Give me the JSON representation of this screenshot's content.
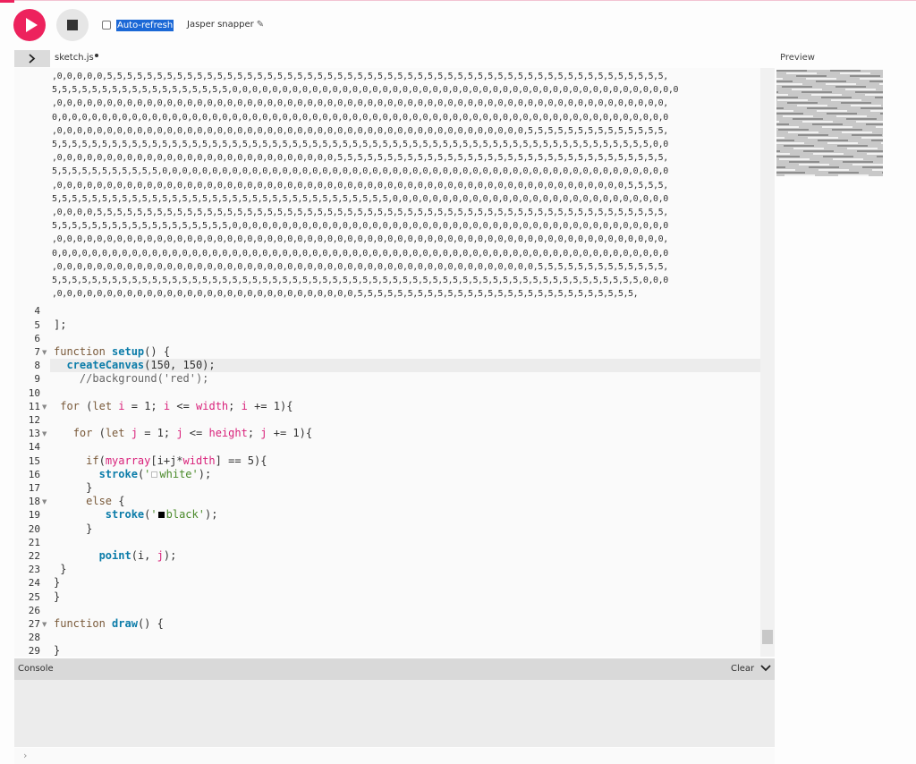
{
  "toolbar": {
    "play_icon": "play-icon",
    "stop_icon": "stop-icon",
    "auto_refresh_label": "Auto-refresh",
    "project_name": "Jasper snapper",
    "pencil_icon": "✎"
  },
  "file_header": {
    "toggle_icon": "chevron-right-icon",
    "file_name": "sketch.js",
    "preview_label": "Preview"
  },
  "editor": {
    "data_lines": [
      ",0,0,0,0,0,5,5,5,5,5,5,5,5,5,5,5,5,5,5,5,5,5,5,5,5,5,5,5,5,5,5,5,5,5,5,5,5,5,5,5,5,5,5,5,5,5,5,5,5,5,5,5,5,5,5,5,5,5,5,5,5,",
      "5,5,5,5,5,5,5,5,5,5,5,5,5,5,5,5,5,5,0,0,0,0,0,0,0,0,0,0,0,0,0,0,0,0,0,0,0,0,0,0,0,0,0,0,0,0,0,0,0,0,0,0,0,0,0,0,0,0,0,0,0,0,0",
      ",0,0,0,0,0,0,0,0,0,0,0,0,0,0,0,0,0,0,0,0,0,0,0,0,0,0,0,0,0,0,0,0,0,0,0,0,0,0,0,0,0,0,0,0,0,0,0,0,0,0,0,0,0,0,0,0,0,0,0,0,0,",
      "0,0,0,0,0,0,0,0,0,0,0,0,0,0,0,0,0,0,0,0,0,0,0,0,0,0,0,0,0,0,0,0,0,0,0,0,0,0,0,0,0,0,0,0,0,0,0,0,0,0,0,0,0,0,0,0,0,0,0,0,0,0",
      ",0,0,0,0,0,0,0,0,0,0,0,0,0,0,0,0,0,0,0,0,0,0,0,0,0,0,0,0,0,0,0,0,0,0,0,0,0,0,0,0,0,0,0,0,0,0,0,5,5,5,5,5,5,5,5,5,5,5,5,5,5,",
      "5,5,5,5,5,5,5,5,5,5,5,5,5,5,5,5,5,5,5,5,5,5,5,5,5,5,5,5,5,5,5,5,5,5,5,5,5,5,5,5,5,5,5,5,5,5,5,5,5,5,5,5,5,5,5,5,5,5,5,5,0,0",
      ",0,0,0,0,0,0,0,0,0,0,0,0,0,0,0,0,0,0,0,0,0,0,0,0,0,0,0,0,5,5,5,5,5,5,5,5,5,5,5,5,5,5,5,5,5,5,5,5,5,5,5,5,5,5,5,5,5,5,5,5,5,",
      "5,5,5,5,5,5,5,5,5,5,5,0,0,0,0,0,0,0,0,0,0,0,0,0,0,0,0,0,0,0,0,0,0,0,0,0,0,0,0,0,0,0,0,0,0,0,0,0,0,0,0,0,0,0,0,0,0,0,0,0,0,0",
      ",0,0,0,0,0,0,0,0,0,0,0,0,0,0,0,0,0,0,0,0,0,0,0,0,0,0,0,0,0,0,0,0,0,0,0,0,0,0,0,0,0,0,0,0,0,0,0,0,0,0,0,0,0,0,0,0,0,5,5,5,5,",
      "5,5,5,5,5,5,5,5,5,5,5,5,5,5,5,5,5,5,5,5,5,5,5,5,5,5,5,5,5,5,5,5,5,5,0,0,0,0,0,0,0,0,0,0,0,0,0,0,0,0,0,0,0,0,0,0,0,0,0,0,0,0",
      ",0,0,0,0,5,5,5,5,5,5,5,5,5,5,5,5,5,5,5,5,5,5,5,5,5,5,5,5,5,5,5,5,5,5,5,5,5,5,5,5,5,5,5,5,5,5,5,5,5,5,5,5,5,5,5,5,5,5,5,5,5,",
      "5,5,5,5,5,5,5,5,5,5,5,5,5,5,5,5,5,5,0,0,0,0,0,0,0,0,0,0,0,0,0,0,0,0,0,0,0,0,0,0,0,0,0,0,0,0,0,0,0,0,0,0,0,0,0,0,0,0,0,0,0,0",
      ",0,0,0,0,0,0,0,0,0,0,0,0,0,0,0,0,0,0,0,0,0,0,0,0,0,0,0,0,0,0,0,0,0,0,0,0,0,0,0,0,0,0,0,0,0,0,0,0,0,0,0,0,0,0,0,0,0,0,0,0,0,",
      "0,0,0,0,0,0,0,0,0,0,0,0,0,0,0,0,0,0,0,0,0,0,0,0,0,0,0,0,0,0,0,0,0,0,0,0,0,0,0,0,0,0,0,0,0,0,0,0,0,0,0,0,0,0,0,0,0,0,0,0,0,0",
      ",0,0,0,0,0,0,0,0,0,0,0,0,0,0,0,0,0,0,0,0,0,0,0,0,0,0,0,0,0,0,0,0,0,0,0,0,0,0,0,0,0,0,0,0,0,0,0,0,5,5,5,5,5,5,5,5,5,5,5,5,5,",
      "5,5,5,5,5,5,5,5,5,5,5,5,5,5,5,5,5,5,5,5,5,5,5,5,5,5,5,5,5,5,5,5,5,5,5,5,5,5,5,5,5,5,5,5,5,5,5,5,5,5,5,5,5,5,5,5,5,5,5,0,0,0",
      ",0,0,0,0,0,0,0,0,0,0,0,0,0,0,0,0,0,0,0,0,0,0,0,0,0,0,0,0,0,0,5,5,5,5,5,5,5,5,5,5,5,5,5,5,5,5,5,5,5,5,5,5,5,5,5,5,5,5,"
    ],
    "code_lines": [
      {
        "num": "4",
        "text": ""
      },
      {
        "num": "5",
        "text": "];"
      },
      {
        "num": "6",
        "text": ""
      },
      {
        "num": "7",
        "text": "function setup() {"
      },
      {
        "num": "8",
        "text": "  createCanvas(150, 150);"
      },
      {
        "num": "9",
        "text": "    //background('red');"
      },
      {
        "num": "10",
        "text": ""
      },
      {
        "num": "11",
        "text": " for (let i = 1; i <= width; i += 1){"
      },
      {
        "num": "12",
        "text": ""
      },
      {
        "num": "13",
        "text": "   for (let j = 1; j <= height; j += 1){"
      },
      {
        "num": "14",
        "text": ""
      },
      {
        "num": "15",
        "text": "     if(myarray[i+j*width] == 5){"
      },
      {
        "num": "16",
        "text": "       stroke('white');"
      },
      {
        "num": "17",
        "text": "     }"
      },
      {
        "num": "18",
        "text": "     else {"
      },
      {
        "num": "19",
        "text": "        stroke('black');"
      },
      {
        "num": "20",
        "text": "     }"
      },
      {
        "num": "21",
        "text": ""
      },
      {
        "num": "22",
        "text": "       point(i, j);"
      },
      {
        "num": "23",
        "text": " }"
      },
      {
        "num": "24",
        "text": "}"
      },
      {
        "num": "25",
        "text": "}"
      },
      {
        "num": "26",
        "text": ""
      },
      {
        "num": "27",
        "text": "function draw() {"
      },
      {
        "num": "28",
        "text": ""
      },
      {
        "num": "29",
        "text": "}"
      }
    ],
    "fold_lines": [
      "7",
      "11",
      "13",
      "18",
      "27"
    ],
    "colors": {
      "keyword": "#7a5a3a",
      "function": "#0b7ca9",
      "variable": "#d9227b",
      "string": "#4a8a2a",
      "white_swatch": "#ffffff",
      "black_swatch": "#000000"
    }
  },
  "console": {
    "title": "Console",
    "clear_label": "Clear",
    "chevron_icon": "chevron-down-icon",
    "prompt_icon": "›"
  },
  "colors": {
    "accent": "#ed225d",
    "stop_bg": "#e6e6e6",
    "selection": "#1b68d6"
  }
}
